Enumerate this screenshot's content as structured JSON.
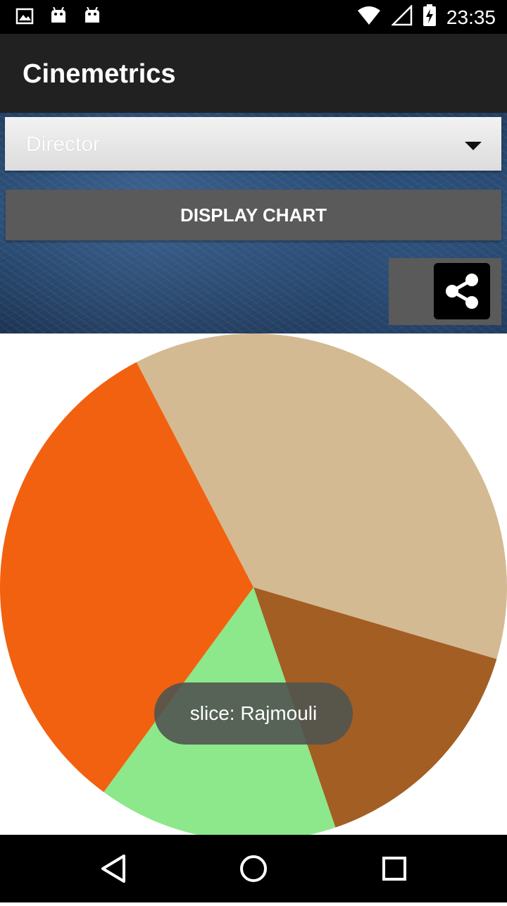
{
  "status_bar": {
    "time": "23:35",
    "left_icons": [
      "image-icon",
      "android-icon",
      "android-icon"
    ],
    "right_icons": [
      "wifi-icon",
      "signal-icon",
      "battery-charging-icon"
    ]
  },
  "app": {
    "title": "Cinemetrics"
  },
  "spinner": {
    "selected": "Director"
  },
  "display_button": {
    "label": "DISPLAY CHART"
  },
  "toast": {
    "text": "slice: Rajmouli"
  },
  "colors": {
    "tan": "#D4BA92",
    "brown": "#A35E24",
    "green": "#8CE88A",
    "orange": "#F2610F"
  },
  "chart_data": {
    "type": "pie",
    "slices": [
      {
        "value": 37.2,
        "color": "#D4BA92"
      },
      {
        "value": 15.2,
        "color": "#A35E24"
      },
      {
        "value": 15.3,
        "color": "#8CE88A"
      },
      {
        "value": 32.3,
        "color": "#F2610F"
      }
    ],
    "title": "",
    "legend": "none"
  },
  "nav_bar": {
    "icons": [
      "back-icon",
      "home-icon",
      "recents-icon"
    ]
  }
}
